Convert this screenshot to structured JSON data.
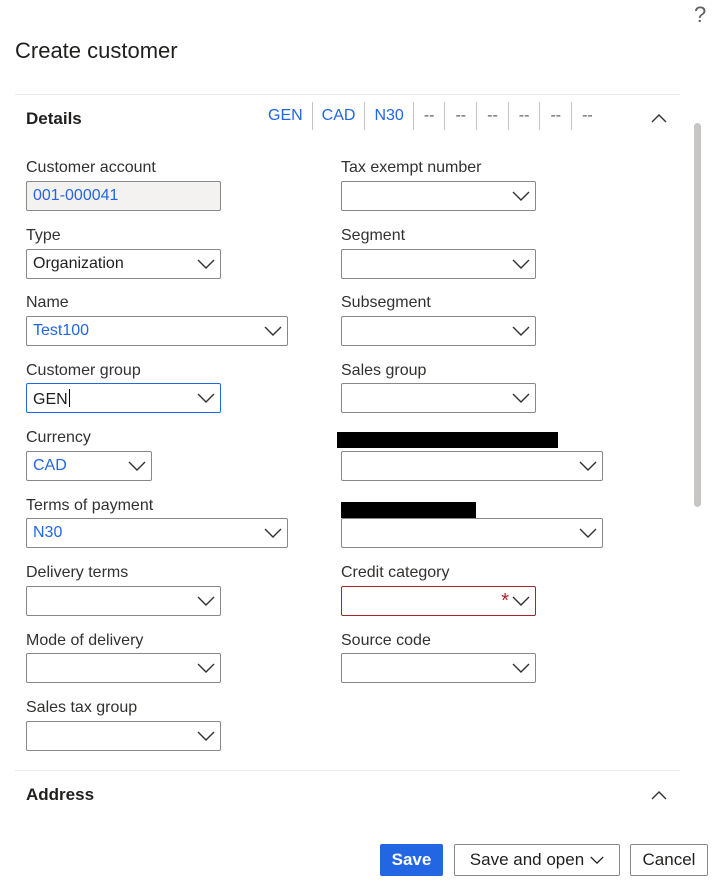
{
  "dialog": {
    "title": "Create customer",
    "help_glyph": "?"
  },
  "details": {
    "title": "Details",
    "summary": [
      "GEN",
      "CAD",
      "N30",
      "--",
      "--",
      "--",
      "--",
      "--",
      "--"
    ],
    "left": [
      {
        "label": "Customer account",
        "value": "001-000041"
      },
      {
        "label": "Type",
        "value": "Organization"
      },
      {
        "label": "Name",
        "value": "Test100"
      },
      {
        "label": "Customer group",
        "value": "GEN"
      },
      {
        "label": "Currency",
        "value": "CAD"
      },
      {
        "label": "Terms of payment",
        "value": "N30"
      },
      {
        "label": "Delivery terms",
        "value": ""
      },
      {
        "label": "Mode of delivery",
        "value": ""
      },
      {
        "label": "Sales tax group",
        "value": ""
      }
    ],
    "right": [
      {
        "label": "Tax exempt number",
        "value": ""
      },
      {
        "label": "Segment",
        "value": ""
      },
      {
        "label": "Subsegment",
        "value": ""
      },
      {
        "label": "Sales group",
        "value": ""
      },
      {
        "label": "",
        "value": ""
      },
      {
        "label": "",
        "value": ""
      },
      {
        "label": "Credit category",
        "value": "",
        "required_mark": "*"
      },
      {
        "label": "Source code",
        "value": ""
      }
    ]
  },
  "address": {
    "title": "Address"
  },
  "footer": {
    "save": "Save",
    "save_and_open": "Save and open",
    "cancel": "Cancel"
  },
  "colors": {
    "accent": "#2266e3",
    "required": "#a4262c",
    "border": "#8a8886"
  }
}
